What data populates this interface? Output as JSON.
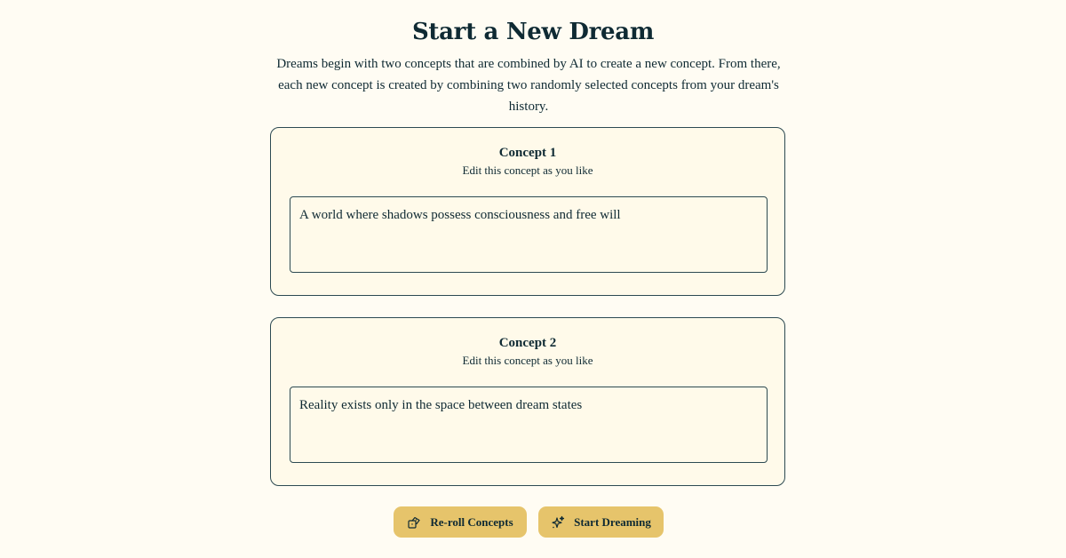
{
  "header": {
    "title": "Start a New Dream",
    "intro": "Dreams begin with two concepts that are combined by AI to create a new concept. From there, each new concept is created by combining two randomly selected concepts from your dream's history."
  },
  "concepts": [
    {
      "title": "Concept 1",
      "subtitle": "Edit this concept as you like",
      "value": "A world where shadows possess consciousness and free will"
    },
    {
      "title": "Concept 2",
      "subtitle": "Edit this concept as you like",
      "value": "Reality exists only in the space between dream states"
    }
  ],
  "actions": {
    "reroll_label": "Re-roll Concepts",
    "reroll_icon": "dice-icon",
    "start_label": "Start Dreaming",
    "start_icon": "sparkles-icon"
  },
  "colors": {
    "background": "#fffcf3",
    "card": "#fffaea",
    "border": "#2d4a52",
    "text": "#0f2a33",
    "button": "#e6c46b"
  }
}
